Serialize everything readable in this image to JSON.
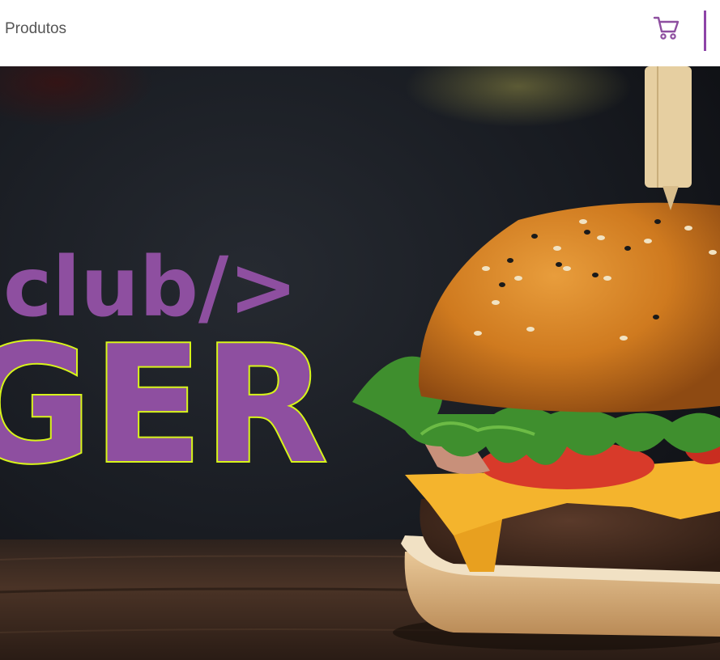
{
  "header": {
    "nav_link_label": "Produtos",
    "cart_icon": "shopping-cart-icon"
  },
  "hero": {
    "logo_top": "club/>",
    "logo_bottom": "GER",
    "image_subject": "burger-photo"
  },
  "colors": {
    "brand_purple": "#8e4fa0",
    "outline_lime": "#d8f51a",
    "header_bg": "#ffffff",
    "link_text": "#555555",
    "hero_bg_dark": "#14161c",
    "table_wood": "#3a2a22"
  }
}
